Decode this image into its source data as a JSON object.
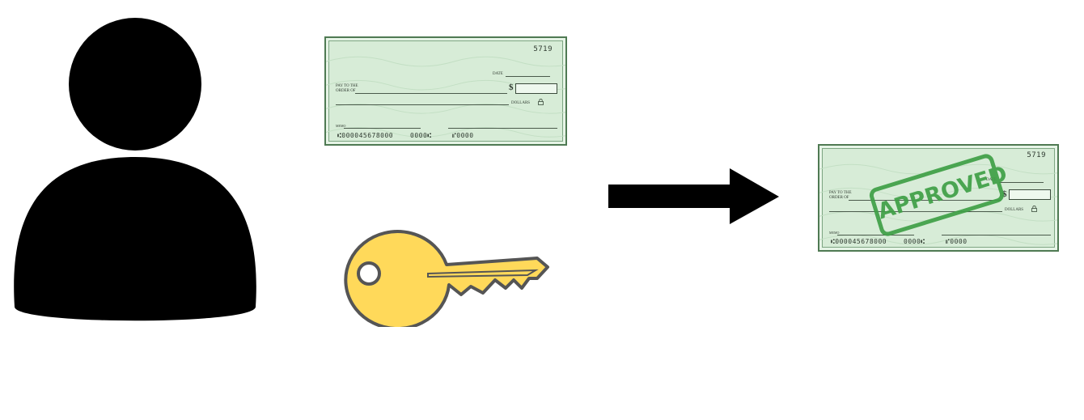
{
  "colors": {
    "person": "#000000",
    "arrow": "#000000",
    "key_fill": "#ffd95a",
    "key_stroke": "#555555",
    "check_bg": "#d7ecd7",
    "stamp": "#3fa046"
  },
  "icons": {
    "person": "person-icon",
    "key": "key-icon",
    "arrow": "arrow-right-icon"
  },
  "check_blank": {
    "number": "5719",
    "date_label": "DATE",
    "pay_to_line1": "PAY TO THE",
    "pay_to_line2": "ORDER OF",
    "dollar_sign": "$",
    "dollars_label": "DOLLARS",
    "memo_label": "MEMO",
    "micr_routing": "⑆000045678000",
    "micr_account": "0000⑆",
    "micr_check": "⑈0000"
  },
  "check_approved": {
    "number": "5719",
    "date_label": "DATE",
    "pay_to_line1": "PAY TO THE",
    "pay_to_line2": "ORDER OF",
    "dollar_sign": "$",
    "dollars_label": "DOLLARS",
    "memo_label": "MEMO",
    "micr_routing": "⑆000045678000",
    "micr_account": "0000⑆",
    "micr_check": "⑈0000",
    "stamp_text": "APPROVED"
  }
}
